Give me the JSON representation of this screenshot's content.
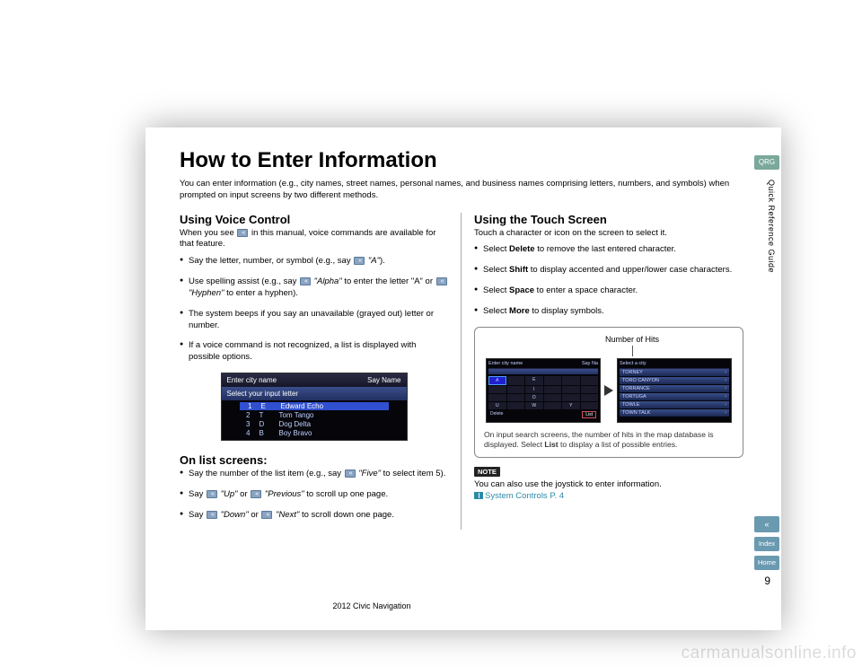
{
  "title": "How to Enter Information",
  "intro": "You can enter information (e.g., city names, street names, personal names, and business names comprising letters, numbers, and symbols) when prompted on input screens by two different methods.",
  "left": {
    "heading": "Using Voice Control",
    "sub": "When you see ⟨talk⟩ in this manual, voice commands are available for that feature.",
    "bullets": [
      {
        "pre": "Say the letter, number, or symbol (e.g., say ",
        "cmd": "\"A\"",
        "post": ")."
      },
      {
        "pre": "Use spelling assist (e.g., say ",
        "cmd": "\"Alpha\"",
        "mid": " to enter the letter \"A\" or ",
        "cmd2": "\"Hyphen\"",
        "post": " to enter a hyphen)."
      },
      {
        "text": "The system beeps if you say an unavailable (grayed out) letter or number."
      },
      {
        "text": "If a voice command is not recognized, a list is displayed with possible options."
      }
    ],
    "screen": {
      "header_left": "Enter city name",
      "header_right": "Say  Name",
      "sub": "Select your input letter",
      "rows": [
        {
          "n": "1",
          "l": "E",
          "w": "Edward Echo",
          "hl": true
        },
        {
          "n": "2",
          "l": "T",
          "w": "Tom Tango"
        },
        {
          "n": "3",
          "l": "D",
          "w": "Dog Delta"
        },
        {
          "n": "4",
          "l": "B",
          "w": "Boy Bravo"
        }
      ]
    },
    "list_heading": "On list screens:",
    "list_bullets": [
      {
        "pre": "Say the number of the list item (e.g., say ",
        "cmd": "\"Five\"",
        "post": " to select item 5)."
      },
      {
        "pre": "Say ",
        "cmd": "\"Up\"",
        "mid": " or ",
        "cmd2": "\"Previous\"",
        "post": " to scroll up one page."
      },
      {
        "pre": "Say ",
        "cmd": "\"Down\"",
        "mid": " or ",
        "cmd2": "\"Next\"",
        "post": " to scroll down one page."
      }
    ]
  },
  "right": {
    "heading": "Using the Touch Screen",
    "sub": "Touch a character or icon on the screen to select it.",
    "bullets": [
      {
        "pre": "Select ",
        "b": "Delete",
        "post": " to remove the last entered character."
      },
      {
        "pre": "Select ",
        "b": "Shift",
        "post": " to display accented and upper/lower case characters."
      },
      {
        "pre": "Select ",
        "b": "Space",
        "post": " to enter a space character."
      },
      {
        "pre": "Select ",
        "b": "More",
        "post": " to display symbols."
      }
    ],
    "numhits": "Number of Hits",
    "kbd": {
      "top_left": "Enter city name",
      "top_right": "Say  Na",
      "letters": [
        "A",
        "",
        "E",
        "",
        "",
        "",
        "",
        "",
        "I",
        "",
        "",
        "",
        "",
        "",
        "O",
        "",
        "",
        "",
        "U",
        "",
        "W",
        "",
        "Y",
        ""
      ],
      "bottom_left": "Delete",
      "bottom_right": "List"
    },
    "listscreen": {
      "top_left": "Select a city",
      "items": [
        "TORNEY",
        "TORO CANYON",
        "TORRANCE",
        "TORTUGA",
        "TOWLE",
        "TOWN TALK"
      ]
    },
    "caption": "On input search screens, the number of hits in the map database is displayed. Select List to display a list of possible entries.",
    "note_badge": "NOTE",
    "note": "You can also use the joystick to enter information.",
    "link": "System Controls",
    "link_page": "P. 4"
  },
  "side": {
    "qrg": "QRG",
    "vert": "Quick Reference Guide",
    "index": "Index",
    "home": "Home"
  },
  "page_num": "9",
  "footer": "2012 Civic Navigation",
  "watermark": "carmanualsonline.info"
}
